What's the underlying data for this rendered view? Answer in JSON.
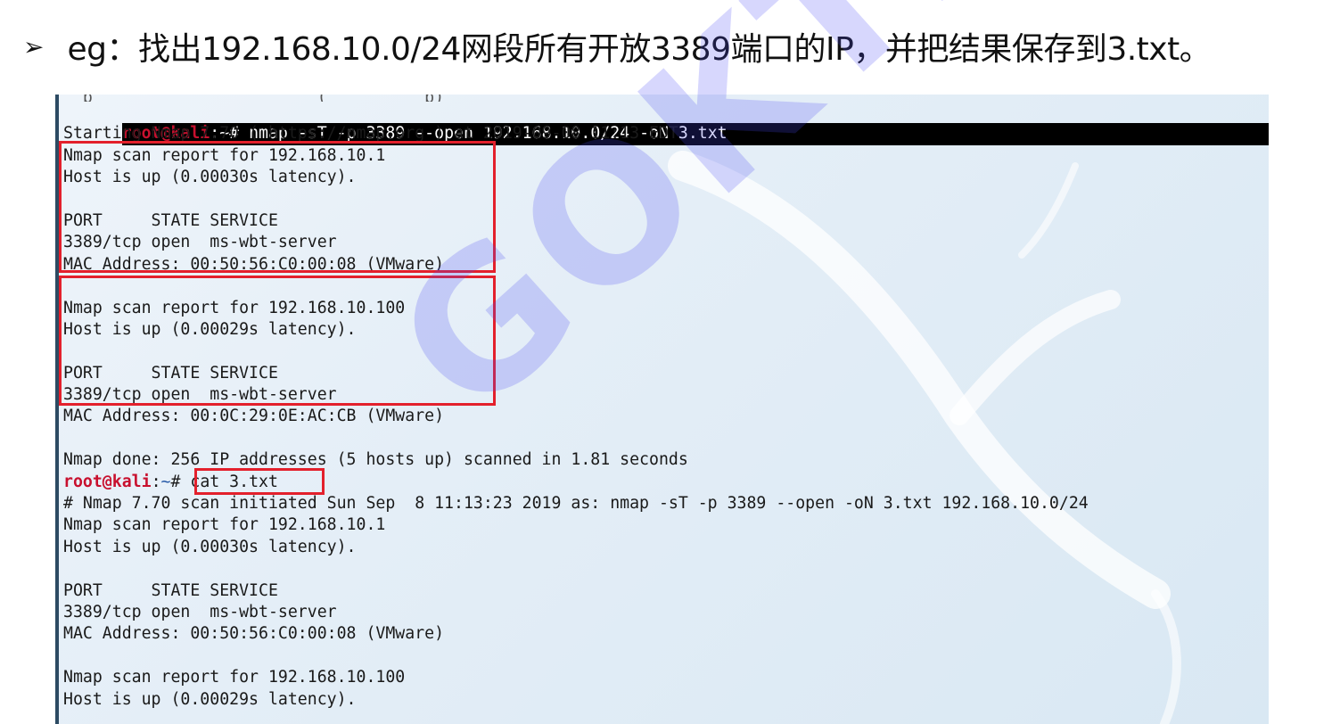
{
  "heading": {
    "bullet": "➢",
    "text": "eg：找出192.168.10.0/24网段所有开放3389端口的IP，并把结果保存到3.txt。"
  },
  "terminal": {
    "partial_top": "  p                       (          p)",
    "prompt1": {
      "user": "root@kali",
      "sep": ":",
      "path": "~",
      "hash": "# ",
      "command": "nmap -sT -p 3389 --open 192.168.10.0/24 -oN 3.txt"
    },
    "lines_a": [
      "Starting Nmap 7.70 ( https://nmap.org ) at 2019-09-08 11:13 EDT",
      "Nmap scan report for 192.168.10.1",
      "Host is up (0.00030s latency).",
      "",
      "PORT     STATE SERVICE",
      "3389/tcp open  ms-wbt-server",
      "MAC Address: 00:50:56:C0:00:08 (VMware)",
      "",
      "Nmap scan report for 192.168.10.100",
      "Host is up (0.00029s latency).",
      "",
      "PORT     STATE SERVICE",
      "3389/tcp open  ms-wbt-server",
      "MAC Address: 00:0C:29:0E:AC:CB (VMware)",
      "",
      "Nmap done: 256 IP addresses (5 hosts up) scanned in 1.81 seconds"
    ],
    "prompt2": {
      "user": "root@kali",
      "sep": ":",
      "path": "~",
      "hash": "# ",
      "command": "cat 3.txt"
    },
    "lines_b": [
      "# Nmap 7.70 scan initiated Sun Sep  8 11:13:23 2019 as: nmap -sT -p 3389 --open -oN 3.txt 192.168.10.0/24",
      "Nmap scan report for 192.168.10.1",
      "Host is up (0.00030s latency).",
      "",
      "PORT     STATE SERVICE",
      "3389/tcp open  ms-wbt-server",
      "MAC Address: 00:50:56:C0:00:08 (VMware)",
      "",
      "Nmap scan report for 192.168.10.100",
      "Host is up (0.00029s latency)."
    ]
  },
  "watermark": {
    "text": "GOKTECH"
  },
  "colors": {
    "highlight_box": "#e3202c",
    "watermark": "#4b4bf5",
    "prompt_user": "#c8102e"
  }
}
